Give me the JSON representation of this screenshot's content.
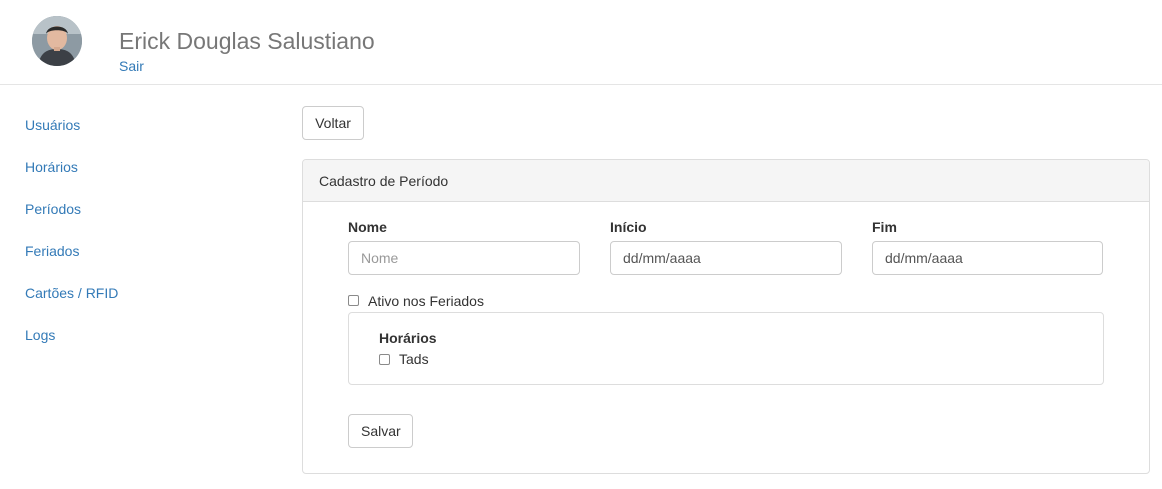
{
  "header": {
    "user_name": "Erick Douglas Salustiano",
    "logout_label": "Sair",
    "avatar_icon": "user-avatar"
  },
  "sidebar": {
    "items": [
      {
        "label": "Usuários"
      },
      {
        "label": "Horários"
      },
      {
        "label": "Períodos"
      },
      {
        "label": "Feriados"
      },
      {
        "label": "Cartões / RFID"
      },
      {
        "label": "Logs"
      }
    ]
  },
  "toolbar": {
    "back_label": "Voltar"
  },
  "panel": {
    "title": "Cadastro de Período",
    "fields": {
      "name": {
        "label": "Nome",
        "placeholder": "Nome",
        "value": ""
      },
      "start": {
        "label": "Início",
        "placeholder": "dd/mm/aaaa",
        "value": "dd/mm/aaaa"
      },
      "end": {
        "label": "Fim",
        "placeholder": "dd/mm/aaaa",
        "value": "dd/mm/aaaa"
      }
    },
    "holiday_checkbox": {
      "label": "Ativo nos Feriados",
      "checked": false
    },
    "schedules": {
      "title": "Horários",
      "items": [
        {
          "label": "Tads",
          "checked": false
        }
      ]
    },
    "save_label": "Salvar"
  },
  "colors": {
    "link": "#337ab7",
    "header_text": "#777777",
    "panel_heading_bg": "#f5f5f5",
    "border": "#dddddd"
  }
}
